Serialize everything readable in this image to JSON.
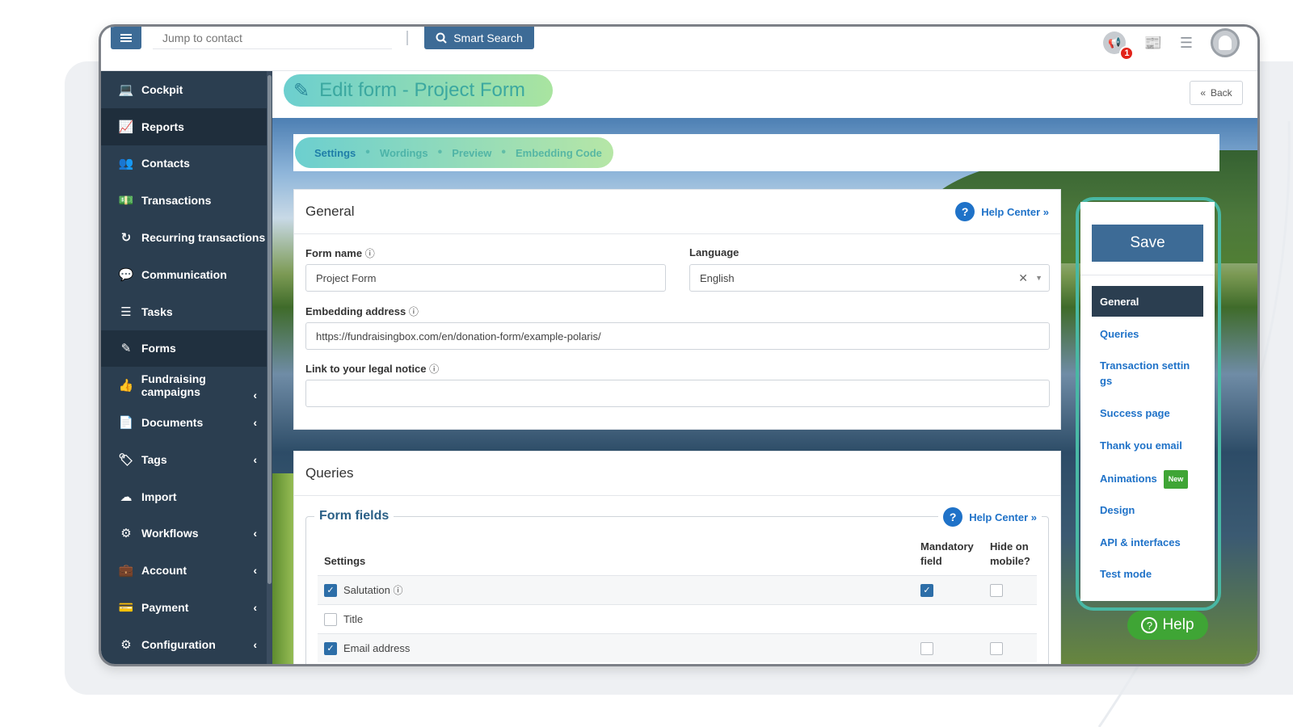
{
  "topbar": {
    "jump_placeholder": "Jump to contact",
    "smart_search_label": "Smart Search",
    "notification_count": "1"
  },
  "sidebar": {
    "items": [
      {
        "label": "Cockpit",
        "icon": "laptop-icon"
      },
      {
        "label": "Reports",
        "icon": "chart-icon"
      },
      {
        "label": "Contacts",
        "icon": "users-icon"
      },
      {
        "label": "Transactions",
        "icon": "money-icon"
      },
      {
        "label": "Recurring transactions",
        "icon": "recurring-icon"
      },
      {
        "label": "Communication",
        "icon": "chat-icon"
      },
      {
        "label": "Tasks",
        "icon": "tasks-icon"
      },
      {
        "label": "Forms",
        "icon": "edit-icon"
      },
      {
        "label": "Fundraising campaigns",
        "icon": "thumbs-up-icon"
      },
      {
        "label": "Documents",
        "icon": "document-icon"
      },
      {
        "label": "Tags",
        "icon": "tags-icon"
      },
      {
        "label": "Import",
        "icon": "cloud-upload-icon"
      },
      {
        "label": "Workflows",
        "icon": "workflow-icon"
      },
      {
        "label": "Account",
        "icon": "briefcase-icon"
      },
      {
        "label": "Payment",
        "icon": "credit-card-icon"
      },
      {
        "label": "Configuration",
        "icon": "gear-icon"
      }
    ]
  },
  "page": {
    "title": "Edit form - Project Form",
    "back_label": "Back"
  },
  "tabs": [
    "Settings",
    "Wordings",
    "Preview",
    "Embedding Code"
  ],
  "general": {
    "title": "General",
    "help_label": "Help Center »",
    "form_name_label": "Form name",
    "form_name_value": "Project Form",
    "language_label": "Language",
    "language_value": "English",
    "embedding_label": "Embedding address",
    "embedding_value": "https://fundraisingbox.com/en/donation-form/example-polaris/",
    "legal_label": "Link to your legal notice",
    "legal_value": ""
  },
  "queries": {
    "title": "Queries",
    "fieldset_title": "Form fields",
    "help_label": "Help Center »",
    "col_settings": "Settings",
    "col_mandatory_1": "Mandatory",
    "col_mandatory_2": "field",
    "col_hide_1": "Hide on",
    "col_hide_2": "mobile?",
    "rows": [
      {
        "label": "Salutation",
        "checked": true,
        "mandatory": true,
        "hide": false
      },
      {
        "label": "Title",
        "checked": false
      },
      {
        "label": "Email address",
        "checked": true,
        "mandatory": false,
        "hide": false
      }
    ]
  },
  "right_panel": {
    "save_label": "Save",
    "items": [
      "General",
      "Queries",
      "Transaction settin gs",
      "Success page",
      "Thank you email",
      "Animations",
      "Design",
      "API & interfaces",
      "Test mode"
    ],
    "new_badge": "New"
  },
  "help_button": "Help",
  "colors": {
    "sidebar": "#2b3e50",
    "primary": "#3d6b96",
    "link": "#1f72c8",
    "accent_green": "#3fa535",
    "pill_start": "#6ccfcf",
    "pill_end": "#a9e4a0"
  }
}
